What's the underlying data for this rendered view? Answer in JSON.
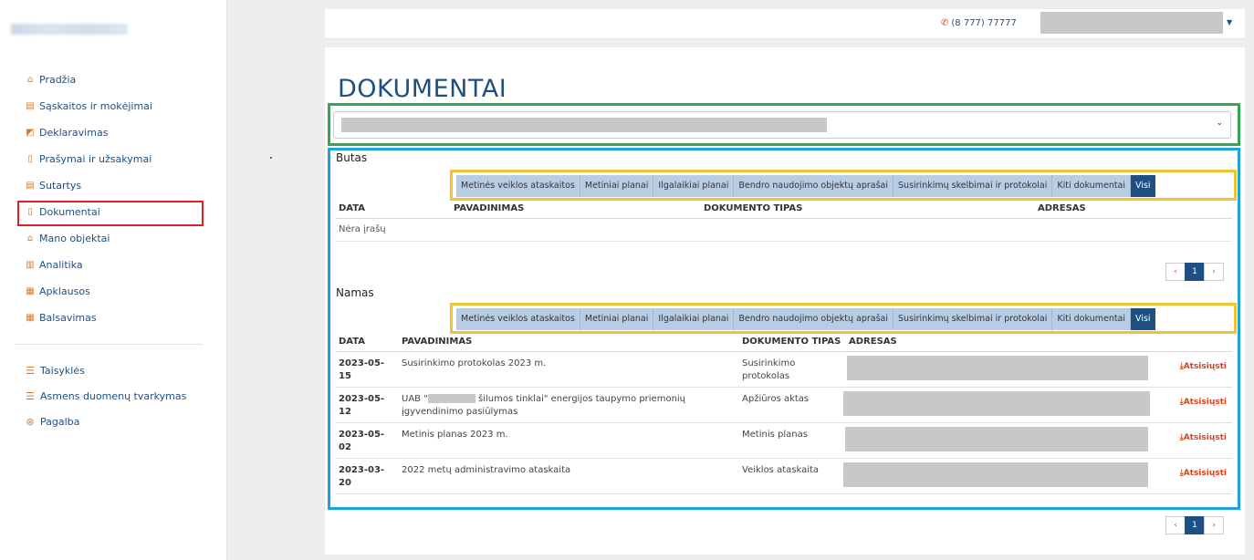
{
  "sidebar": {
    "items": [
      {
        "label": "Pradžia",
        "icon": "home-icon"
      },
      {
        "label": "Sąskaitos ir mokėjimai",
        "icon": "invoice-icon"
      },
      {
        "label": "Deklaravimas",
        "icon": "chart-box-icon"
      },
      {
        "label": "Prašymai ir užsakymai",
        "icon": "file-icon"
      },
      {
        "label": "Sutartys",
        "icon": "contract-icon"
      },
      {
        "label": "Dokumentai",
        "icon": "document-icon"
      },
      {
        "label": "Mano objektai",
        "icon": "home-icon"
      },
      {
        "label": "Analitika",
        "icon": "bar-chart-icon"
      },
      {
        "label": "Apklausos",
        "icon": "poll-icon"
      },
      {
        "label": "Balsavimas",
        "icon": "vote-icon"
      }
    ],
    "items2": [
      {
        "label": "Taisyklės",
        "icon": "list-icon"
      },
      {
        "label": "Asmens duomenų tvarkymas",
        "icon": "list-icon"
      },
      {
        "label": "Pagalba",
        "icon": "lifebuoy-icon"
      }
    ]
  },
  "header": {
    "phone": "(8 777) 77777"
  },
  "main": {
    "title": "DOKUMENTAI",
    "tabs": [
      "Metinės veiklos ataskaitos",
      "Metiniai planai",
      "Ilgalaikiai planai",
      "Bendro naudojimo objektų aprašai",
      "Susirinkimų skelbimai ir protokolai",
      "Kiti dokumentai",
      "Visi"
    ],
    "butas": {
      "title": "Butas",
      "columns": [
        "DATA",
        "PAVADINIMAS",
        "DOKUMENTO TIPAS",
        "ADRESAS"
      ],
      "empty": "Nėra įrašų",
      "page": "1"
    },
    "namas": {
      "title": "Namas",
      "columns": [
        "DATA",
        "PAVADINIMAS",
        "DOKUMENTO TIPAS",
        "ADRESAS"
      ],
      "rows": [
        {
          "date": "2023-05-15",
          "name": "Susirinkimo protokolas 2023 m.",
          "type": "Susirinkimo protokolas"
        },
        {
          "date": "2023-05-12",
          "name_pre": "UAB \"",
          "name_post": " šilumos tinklai\" energijos taupymo priemonių įgyvendinimo pasiūlymas",
          "type": "Apžiūros aktas"
        },
        {
          "date": "2023-05-02",
          "name": "Metinis planas 2023 m.",
          "type": "Metinis planas"
        },
        {
          "date": "2023-03-20",
          "name": "2022 metų administravimo ataskaita",
          "type": "Veiklos ataskaita"
        }
      ],
      "download_label": "Atsisiųsti",
      "page": "1"
    }
  },
  "colors": {
    "primary": "#1f4f82",
    "accent": "#d9421c",
    "tab_bg": "#b8cde3"
  }
}
